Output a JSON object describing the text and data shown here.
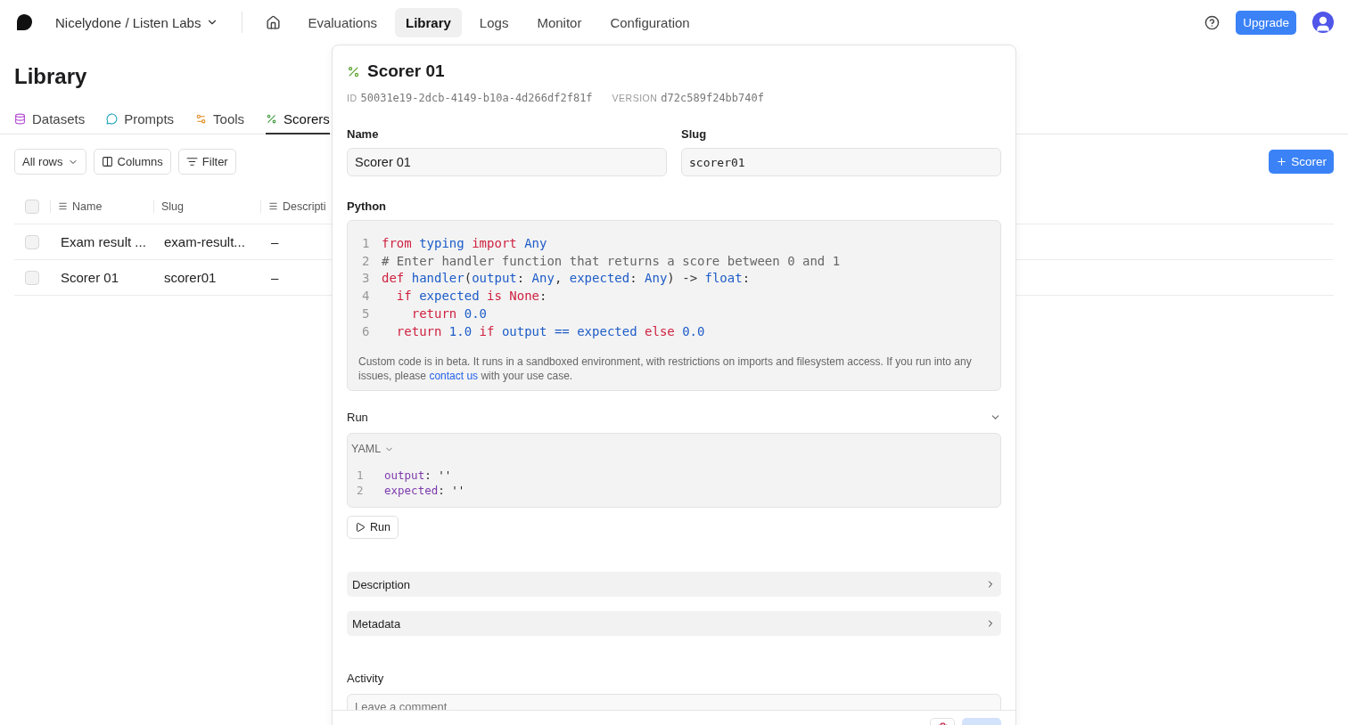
{
  "topbar": {
    "org": "Nicelydone / Listen Labs",
    "nav": [
      {
        "label": "Evaluations",
        "selected": false
      },
      {
        "label": "Library",
        "selected": true
      },
      {
        "label": "Logs",
        "selected": false
      },
      {
        "label": "Monitor",
        "selected": false
      },
      {
        "label": "Configuration",
        "selected": false
      }
    ],
    "upgrade": "Upgrade"
  },
  "page": {
    "title": "Library",
    "tabs": [
      {
        "label": "Datasets",
        "kind": "datasets",
        "selected": false
      },
      {
        "label": "Prompts",
        "kind": "prompts",
        "selected": false
      },
      {
        "label": "Tools",
        "kind": "tools",
        "selected": false
      },
      {
        "label": "Scorers",
        "kind": "scorers",
        "selected": true
      }
    ],
    "toolbar": [
      "All rows",
      "Columns",
      "Filter"
    ],
    "add_button": "Scorer",
    "select_all_checked": false,
    "columns": [
      "Name",
      "Slug",
      "Descripti"
    ],
    "rows": [
      {
        "name": "Exam result ...",
        "slug": "exam-result...",
        "description": "–",
        "checked": false
      },
      {
        "name": "Scorer 01",
        "slug": "scorer01",
        "description": "–",
        "checked": false
      }
    ]
  },
  "panel": {
    "title": "Scorer 01",
    "id_label": "ID",
    "id": "50031e19-2dcb-4149-b10a-4d266df2f81f",
    "version_label": "VERSION",
    "version": "d72c589f24bb740f",
    "name_label": "Name",
    "name_value": "Scorer 01",
    "slug_label": "Slug",
    "slug_value": "scorer01",
    "python_label": "Python",
    "code": [
      {
        "n": "1",
        "tokens": [
          {
            "kind": "kw",
            "t": "from "
          },
          {
            "kind": "id",
            "t": "typing "
          },
          {
            "kind": "kw",
            "t": "import "
          },
          {
            "kind": "id",
            "t": "Any"
          }
        ]
      },
      {
        "n": "2",
        "tokens": [
          {
            "kind": "comment",
            "t": "# Enter handler function that returns a score between 0 and 1"
          }
        ]
      },
      {
        "n": "3",
        "tokens": [
          {
            "kind": "kw",
            "t": "def "
          },
          {
            "kind": "id",
            "t": "handler"
          },
          {
            "kind": "plain",
            "t": "("
          },
          {
            "kind": "id",
            "t": "output"
          },
          {
            "kind": "plain",
            "t": ": "
          },
          {
            "kind": "id",
            "t": "Any"
          },
          {
            "kind": "plain",
            "t": ", "
          },
          {
            "kind": "id",
            "t": "expected"
          },
          {
            "kind": "plain",
            "t": ": "
          },
          {
            "kind": "id",
            "t": "Any"
          },
          {
            "kind": "plain",
            "t": ") -> "
          },
          {
            "kind": "id",
            "t": "float"
          },
          {
            "kind": "plain",
            "t": ":"
          }
        ]
      },
      {
        "n": "4",
        "tokens": [
          {
            "kind": "kw",
            "t": "  if "
          },
          {
            "kind": "id",
            "t": "expected "
          },
          {
            "kind": "kw",
            "t": "is None"
          },
          {
            "kind": "plain",
            "t": ":"
          }
        ]
      },
      {
        "n": "5",
        "tokens": [
          {
            "kind": "kw",
            "t": "    return "
          },
          {
            "kind": "id",
            "t": "0.0"
          }
        ]
      },
      {
        "n": "6",
        "tokens": [
          {
            "kind": "kw",
            "t": "  return "
          },
          {
            "kind": "id",
            "t": "1.0 "
          },
          {
            "kind": "kw",
            "t": "if "
          },
          {
            "kind": "id",
            "t": "output == expected "
          },
          {
            "kind": "kw",
            "t": "else "
          },
          {
            "kind": "id",
            "t": "0.0"
          }
        ]
      }
    ],
    "note_before": "Custom code is in beta. It runs in a sandboxed environment, with restrictions on imports and filesystem access. If you run into any issues, please",
    "note_link": "contact us",
    "note_after": "with your use case.",
    "run": {
      "label": "Run",
      "expanded": true,
      "language": "YAML",
      "lines": [
        {
          "n": "1",
          "key": "output",
          "punct": ":",
          "value": "''"
        },
        {
          "n": "2",
          "key": "expected",
          "punct": ":",
          "value": "''"
        }
      ],
      "button": "Run"
    },
    "sections": [
      {
        "label": "Description",
        "expanded": false
      },
      {
        "label": "Metadata",
        "expanded": false
      }
    ],
    "activity_label": "Activity",
    "comment_placeholder": "Leave a comment"
  }
}
